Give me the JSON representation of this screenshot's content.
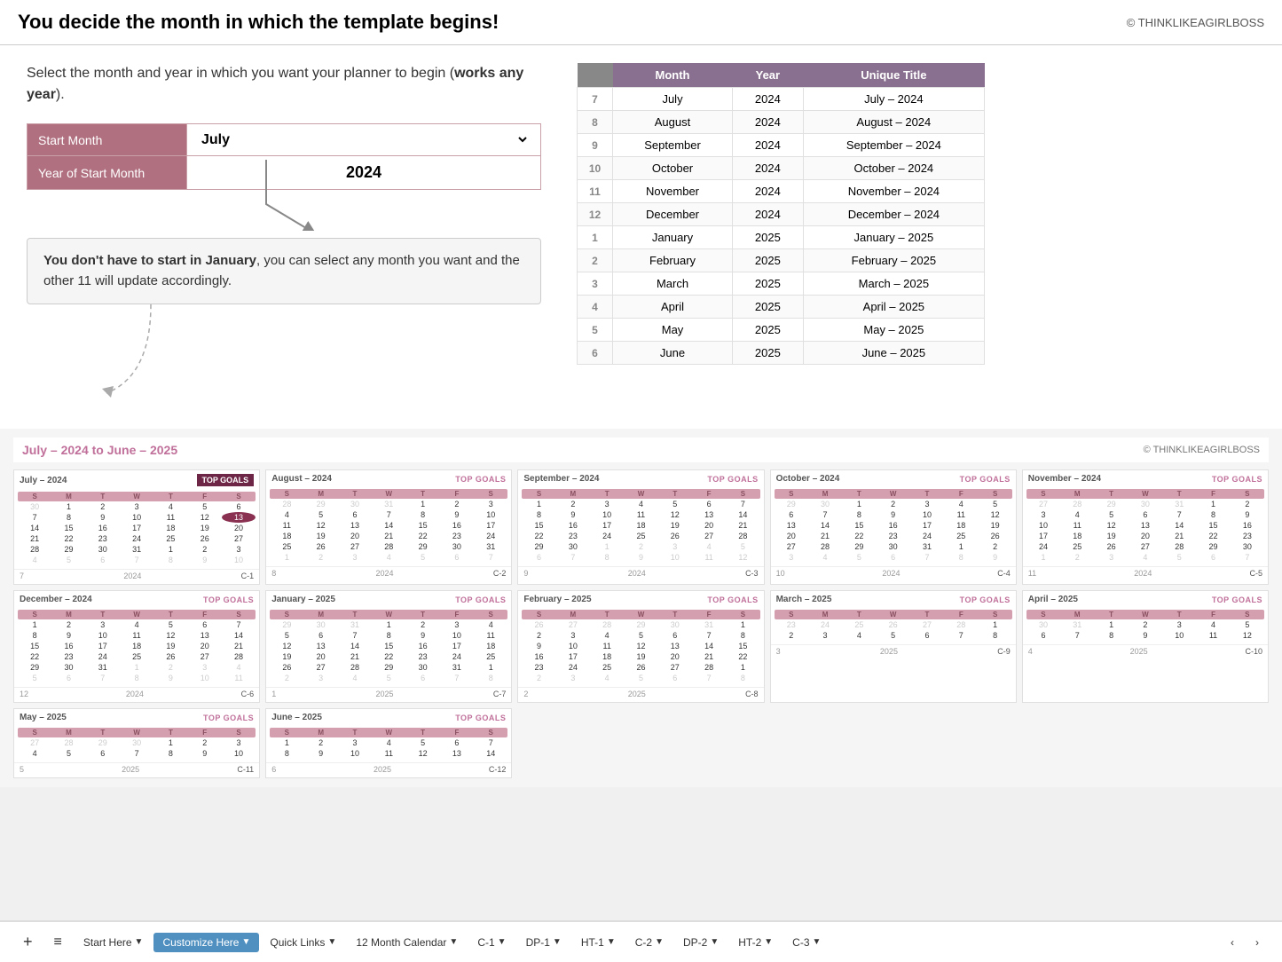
{
  "header": {
    "title": "You decide the month in which the template begins!",
    "copyright": "© THINKLIKEAGIRLBOSS"
  },
  "intro": {
    "text1": "Select the month and year in which you want your planner to begin (",
    "bold": "works any year",
    "text2": ")."
  },
  "inputs": {
    "start_month_label": "Start Month",
    "start_month_value": "July",
    "year_label": "Year of Start Month",
    "year_value": "2024"
  },
  "note": {
    "bold": "You don't have to start in January",
    "rest": ", you can select any month you want and the other 11 will update accordingly."
  },
  "table": {
    "headers": [
      "Month",
      "Year",
      "Unique Title"
    ],
    "rows": [
      {
        "num": "7",
        "month": "July",
        "year": "2024",
        "title": "July – 2024"
      },
      {
        "num": "8",
        "month": "August",
        "year": "2024",
        "title": "August – 2024"
      },
      {
        "num": "9",
        "month": "September",
        "year": "2024",
        "title": "September – 2024"
      },
      {
        "num": "10",
        "month": "October",
        "year": "2024",
        "title": "October – 2024"
      },
      {
        "num": "11",
        "month": "November",
        "year": "2024",
        "title": "November – 2024"
      },
      {
        "num": "12",
        "month": "December",
        "year": "2024",
        "title": "December – 2024"
      },
      {
        "num": "1",
        "month": "January",
        "year": "2025",
        "title": "January – 2025"
      },
      {
        "num": "2",
        "month": "February",
        "year": "2025",
        "title": "February – 2025"
      },
      {
        "num": "3",
        "month": "March",
        "year": "2025",
        "title": "March – 2025"
      },
      {
        "num": "4",
        "month": "April",
        "year": "2025",
        "title": "April – 2025"
      },
      {
        "num": "5",
        "month": "May",
        "year": "2025",
        "title": "May – 2025"
      },
      {
        "num": "6",
        "month": "June",
        "year": "2025",
        "title": "June – 2025"
      }
    ]
  },
  "calendar_section": {
    "date_range": "July – 2024 to June – 2025",
    "copyright": "© THINKLIKEAGIRLBOSS"
  },
  "calendars": [
    {
      "title": "July – 2024",
      "goals_dark": true,
      "dow": [
        "S",
        "M",
        "T",
        "W",
        "T",
        "F",
        "S"
      ],
      "weeks": [
        [
          "30",
          "1",
          "2",
          "3",
          "4",
          "5",
          "6"
        ],
        [
          "7",
          "8",
          "9",
          "10",
          "11",
          "12",
          "13"
        ],
        [
          "14",
          "15",
          "16",
          "17",
          "18",
          "19",
          "20"
        ],
        [
          "21",
          "22",
          "23",
          "24",
          "25",
          "26",
          "27"
        ],
        [
          "28",
          "29",
          "30",
          "31",
          "1",
          "2",
          "3"
        ],
        [
          "4",
          "5",
          "6",
          "7",
          "8",
          "9",
          "10"
        ]
      ],
      "grayed_start": [
        true,
        false,
        false,
        false,
        false,
        false,
        false
      ],
      "grayed_end": [
        false,
        false,
        false,
        false,
        true,
        true,
        true
      ],
      "last_row_gray": true,
      "month_num": "7",
      "year_label": "2024",
      "code": "C-1",
      "today": "13"
    },
    {
      "title": "August – 2024",
      "goals_dark": false,
      "dow": [
        "S",
        "M",
        "T",
        "W",
        "T",
        "F",
        "S"
      ],
      "weeks": [
        [
          "28",
          "29",
          "30",
          "31",
          "1",
          "2",
          "3"
        ],
        [
          "4",
          "5",
          "6",
          "7",
          "8",
          "9",
          "10"
        ],
        [
          "11",
          "12",
          "13",
          "14",
          "15",
          "16",
          "17"
        ],
        [
          "18",
          "19",
          "20",
          "21",
          "22",
          "23",
          "24"
        ],
        [
          "25",
          "26",
          "27",
          "28",
          "29",
          "30",
          "31"
        ],
        [
          "1",
          "2",
          "3",
          "4",
          "5",
          "6",
          "7"
        ]
      ],
      "grayed_start": [
        true,
        true,
        true,
        true,
        false,
        false,
        false
      ],
      "last_row_gray": true,
      "month_num": "8",
      "year_label": "2024",
      "code": "C-2"
    },
    {
      "title": "September – 2024",
      "goals_dark": false,
      "dow": [
        "S",
        "M",
        "T",
        "W",
        "T",
        "F",
        "S"
      ],
      "weeks": [
        [
          "1",
          "2",
          "3",
          "4",
          "5",
          "6",
          "7"
        ],
        [
          "8",
          "9",
          "10",
          "11",
          "12",
          "13",
          "14"
        ],
        [
          "15",
          "16",
          "17",
          "18",
          "19",
          "20",
          "21"
        ],
        [
          "22",
          "23",
          "24",
          "25",
          "26",
          "27",
          "28"
        ],
        [
          "29",
          "30",
          "1",
          "2",
          "3",
          "4",
          "5"
        ],
        [
          "6",
          "7",
          "8",
          "9",
          "10",
          "11",
          "12"
        ]
      ],
      "last_row_gray": true,
      "grayed_end_row4": [
        false,
        false,
        true,
        true,
        true,
        true,
        true
      ],
      "month_num": "9",
      "year_label": "2024",
      "code": "C-3"
    },
    {
      "title": "October – 2024",
      "goals_dark": false,
      "dow": [
        "S",
        "M",
        "T",
        "W",
        "T",
        "F",
        "S"
      ],
      "weeks": [
        [
          "29",
          "30",
          "1",
          "2",
          "3",
          "4",
          "5"
        ],
        [
          "6",
          "7",
          "8",
          "9",
          "10",
          "11",
          "12"
        ],
        [
          "13",
          "14",
          "15",
          "16",
          "17",
          "18",
          "19"
        ],
        [
          "20",
          "21",
          "22",
          "23",
          "24",
          "25",
          "26"
        ],
        [
          "27",
          "28",
          "29",
          "30",
          "31",
          "1",
          "2"
        ],
        [
          "3",
          "4",
          "5",
          "6",
          "7",
          "8",
          "9"
        ]
      ],
      "grayed_start": [
        true,
        true,
        false,
        false,
        false,
        false,
        false
      ],
      "last_row_gray": true,
      "month_num": "10",
      "year_label": "2024",
      "code": "C-4"
    },
    {
      "title": "November – 2024",
      "goals_dark": false,
      "dow": [
        "S",
        "M",
        "T",
        "W",
        "T",
        "F",
        "S"
      ],
      "weeks": [
        [
          "27",
          "28",
          "29",
          "30",
          "31",
          "1",
          "2"
        ],
        [
          "3",
          "4",
          "5",
          "6",
          "7",
          "8",
          "9"
        ],
        [
          "10",
          "11",
          "12",
          "13",
          "14",
          "15",
          "16"
        ],
        [
          "17",
          "18",
          "19",
          "20",
          "21",
          "22",
          "23"
        ],
        [
          "24",
          "25",
          "26",
          "27",
          "28",
          "29",
          "30"
        ],
        [
          "1",
          "2",
          "3",
          "4",
          "5",
          "6",
          "7"
        ]
      ],
      "grayed_start": [
        true,
        true,
        true,
        true,
        true,
        false,
        false
      ],
      "last_row_gray": true,
      "month_num": "11",
      "year_label": "2024",
      "code": "C-5"
    },
    {
      "title": "December – 2024",
      "goals_dark": false,
      "dow": [
        "S",
        "M",
        "T",
        "W",
        "T",
        "F",
        "S"
      ],
      "weeks": [
        [
          "1",
          "2",
          "3",
          "4",
          "5",
          "6",
          "7"
        ],
        [
          "8",
          "9",
          "10",
          "11",
          "12",
          "13",
          "14"
        ],
        [
          "15",
          "16",
          "17",
          "18",
          "19",
          "20",
          "21"
        ],
        [
          "22",
          "23",
          "24",
          "25",
          "26",
          "27",
          "28"
        ],
        [
          "29",
          "30",
          "31",
          "1",
          "2",
          "3",
          "4"
        ],
        [
          "5",
          "6",
          "7",
          "8",
          "9",
          "10",
          "11"
        ]
      ],
      "grayed_end_row4": [
        false,
        false,
        false,
        true,
        true,
        true,
        true
      ],
      "last_row_gray": true,
      "month_num": "12",
      "year_label": "2024",
      "code": "C-6"
    },
    {
      "title": "January – 2025",
      "goals_dark": false,
      "dow": [
        "S",
        "M",
        "T",
        "W",
        "T",
        "F",
        "S"
      ],
      "weeks": [
        [
          "29",
          "30",
          "31",
          "1",
          "2",
          "3",
          "4"
        ],
        [
          "5",
          "6",
          "7",
          "8",
          "9",
          "10",
          "11"
        ],
        [
          "12",
          "13",
          "14",
          "15",
          "16",
          "17",
          "18"
        ],
        [
          "19",
          "20",
          "21",
          "22",
          "23",
          "24",
          "25"
        ],
        [
          "26",
          "27",
          "28",
          "29",
          "30",
          "31",
          "1"
        ],
        [
          "2",
          "3",
          "4",
          "5",
          "6",
          "7",
          "8"
        ]
      ],
      "grayed_start": [
        true,
        true,
        true,
        false,
        false,
        false,
        false
      ],
      "last_row_gray": true,
      "month_num": "1",
      "year_label": "2025",
      "code": "C-7"
    },
    {
      "title": "February – 2025",
      "goals_dark": false,
      "dow": [
        "S",
        "M",
        "T",
        "W",
        "T",
        "F",
        "S"
      ],
      "weeks": [
        [
          "26",
          "27",
          "28",
          "29",
          "30",
          "31",
          "1"
        ],
        [
          "2",
          "3",
          "4",
          "5",
          "6",
          "7",
          "8"
        ],
        [
          "9",
          "10",
          "11",
          "12",
          "13",
          "14",
          "15"
        ],
        [
          "16",
          "17",
          "18",
          "19",
          "20",
          "21",
          "22"
        ],
        [
          "23",
          "24",
          "25",
          "26",
          "27",
          "28",
          "1"
        ],
        [
          "2",
          "3",
          "4",
          "5",
          "6",
          "7",
          "8"
        ]
      ],
      "grayed_start": [
        true,
        true,
        true,
        true,
        true,
        true,
        false
      ],
      "last_row_gray": true,
      "month_num": "2",
      "year_label": "2025",
      "code": "C-8"
    },
    {
      "title": "March – 2025",
      "goals_dark": false,
      "dow": [
        "S",
        "M",
        "T",
        "W",
        "T",
        "F",
        "S"
      ],
      "weeks": [
        [
          "23",
          "24",
          "25",
          "26",
          "27",
          "28",
          "1"
        ],
        [
          "2",
          "3",
          "4",
          "5",
          "6",
          "7",
          "8"
        ]
      ],
      "grayed_start_row0": [
        true,
        true,
        true,
        true,
        true,
        true,
        false
      ],
      "month_num": "3",
      "year_label": "2025",
      "code": "C-9"
    },
    {
      "title": "April – 2025",
      "goals_dark": false,
      "dow": [
        "S",
        "M",
        "T",
        "W",
        "T",
        "F",
        "S"
      ],
      "weeks": [
        [
          "30",
          "31",
          "1",
          "2",
          "3",
          "4",
          "5"
        ],
        [
          "6",
          "7",
          "8",
          "9",
          "10",
          "11",
          "12"
        ]
      ],
      "grayed_start_row0": [
        true,
        true,
        false,
        false,
        false,
        false,
        false
      ],
      "month_num": "4",
      "year_label": "2025",
      "code": "C-10"
    },
    {
      "title": "May – 2025",
      "goals_dark": false,
      "dow": [
        "S",
        "M",
        "T",
        "W",
        "T",
        "F",
        "S"
      ],
      "weeks": [
        [
          "27",
          "28",
          "29",
          "30",
          "1",
          "2",
          "3"
        ],
        [
          "4",
          "5",
          "6",
          "7",
          "8",
          "9",
          "10"
        ]
      ],
      "grayed_start_row0": [
        true,
        true,
        true,
        true,
        false,
        false,
        false
      ],
      "month_num": "5",
      "year_label": "2025",
      "code": "C-11"
    },
    {
      "title": "June – 2025",
      "goals_dark": false,
      "dow": [
        "S",
        "M",
        "T",
        "W",
        "T",
        "F",
        "S"
      ],
      "weeks": [
        [
          "1",
          "2",
          "3",
          "4",
          "5",
          "6",
          "7"
        ],
        [
          "8",
          "9",
          "10",
          "11",
          "12",
          "13",
          "14"
        ]
      ],
      "month_num": "6",
      "year_label": "2025",
      "code": "C-12"
    }
  ],
  "bottom_bar": {
    "plus": "+",
    "menu": "≡",
    "tabs": [
      {
        "label": "Start Here",
        "arrow": "▼",
        "active": false
      },
      {
        "label": "Customize Here",
        "arrow": "▼",
        "active": true
      },
      {
        "label": "Quick Links",
        "arrow": "▼",
        "active": false
      },
      {
        "label": "12 Month Calendar",
        "arrow": "▼",
        "active": false
      },
      {
        "label": "C-1",
        "arrow": "▼",
        "active": false
      },
      {
        "label": "DP-1",
        "arrow": "▼",
        "active": false
      },
      {
        "label": "HT-1",
        "arrow": "▼",
        "active": false
      },
      {
        "label": "C-2",
        "arrow": "▼",
        "active": false
      },
      {
        "label": "DP-2",
        "arrow": "▼",
        "active": false
      },
      {
        "label": "HT-2",
        "arrow": "▼",
        "active": false
      },
      {
        "label": "C-3",
        "arrow": "▼",
        "active": false
      }
    ],
    "nav_left": "‹",
    "nav_right": "›"
  },
  "month_calendar_label": "Month Calendar"
}
